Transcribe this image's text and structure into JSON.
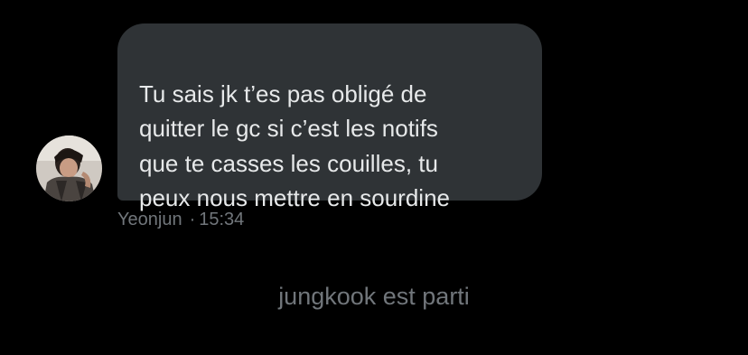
{
  "message": {
    "text": "Tu sais jk t’es pas obligé de\nquitter le gc si c’est les notifs\nque te casses les couilles, tu\npeux nous mettre en sourdine",
    "sender": "Yeonjun",
    "separator": "·",
    "time": "15:34",
    "avatar_icon": "user-avatar-photo"
  },
  "system_event": {
    "text": "jungkook est parti"
  },
  "colors": {
    "background": "#000000",
    "bubble": "#2f3336",
    "bubble_text": "#e7e9ea",
    "secondary_text": "#71767b"
  }
}
